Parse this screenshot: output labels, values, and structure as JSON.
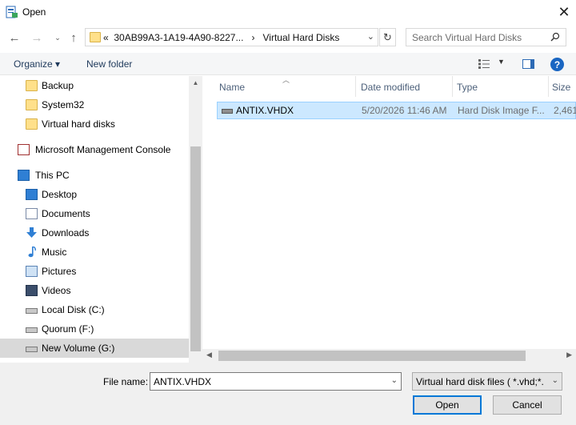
{
  "window": {
    "title": "Open"
  },
  "address": {
    "path_prefix": "«",
    "path_segment_1": "30AB99A3-1A19-4A90-8227...",
    "path_separator": "›",
    "path_segment_2": "Virtual Hard Disks"
  },
  "search": {
    "placeholder": "Search Virtual Hard Disks"
  },
  "toolbar": {
    "organize_label": "Organize ▾",
    "new_folder_label": "New folder",
    "help_label": "?"
  },
  "nav": {
    "items": [
      {
        "label": "Backup",
        "icon": "folder-icon"
      },
      {
        "label": "System32",
        "icon": "folder-icon"
      },
      {
        "label": "Virtual hard disks",
        "icon": "folder-icon"
      },
      {
        "label": "Microsoft Management Console",
        "icon": "mmc-icon"
      },
      {
        "label": "This PC",
        "icon": "computer-icon"
      },
      {
        "label": "Desktop",
        "icon": "desktop-icon"
      },
      {
        "label": "Documents",
        "icon": "documents-icon"
      },
      {
        "label": "Downloads",
        "icon": "downloads-icon"
      },
      {
        "label": "Music",
        "icon": "music-icon"
      },
      {
        "label": "Pictures",
        "icon": "pictures-icon"
      },
      {
        "label": "Videos",
        "icon": "videos-icon"
      },
      {
        "label": "Local Disk (C:)",
        "icon": "drive-icon"
      },
      {
        "label": "Quorum (F:)",
        "icon": "drive-icon"
      },
      {
        "label": "New Volume (G:)",
        "icon": "drive-icon",
        "selected": true
      }
    ]
  },
  "columns": {
    "name": "Name",
    "date": "Date modified",
    "type": "Type",
    "size": "Size"
  },
  "files": [
    {
      "name": "ANTIX.VHDX",
      "date": "5/20/2026 11:46 AM",
      "type": "Hard Disk Image F...",
      "size": "2,461,"
    }
  ],
  "bottom": {
    "file_name_label": "File name:",
    "file_name_value": "ANTIX.VHDX",
    "filter_value": "Virtual hard disk files   ( *.vhd;*.",
    "open_label": "Open",
    "cancel_label": "Cancel"
  },
  "colors": {
    "selection": "#cce8ff",
    "accent": "#0078d7",
    "link": "#1e395b"
  }
}
